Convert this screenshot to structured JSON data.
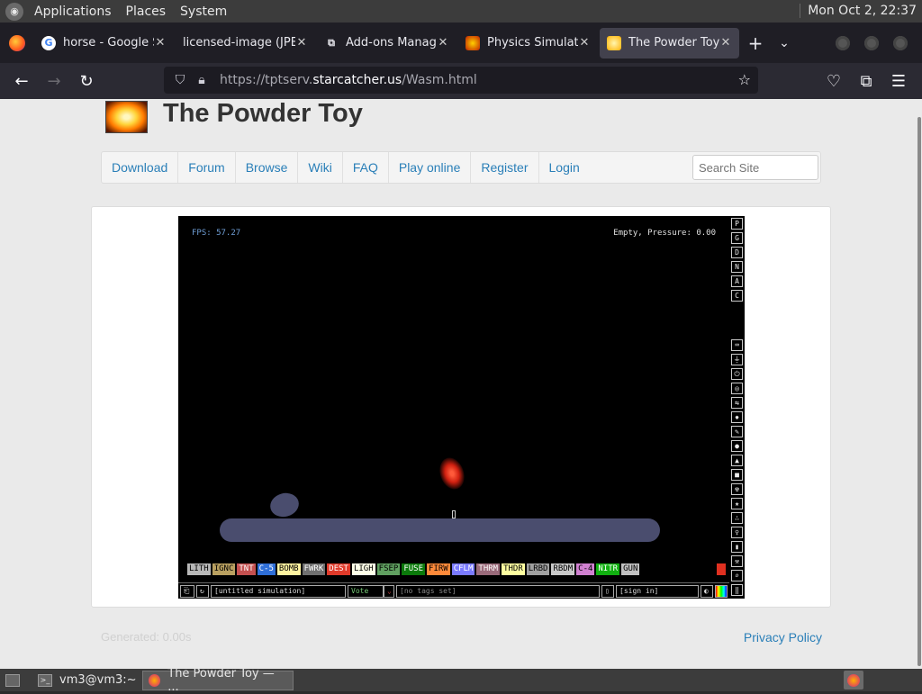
{
  "desktop": {
    "menus": [
      "Applications",
      "Places",
      "System"
    ],
    "clock": "Mon Oct  2, 22:37"
  },
  "browser": {
    "tabs": [
      {
        "title": "horse - Google S",
        "icon": "google-icon",
        "active": false
      },
      {
        "title": "licensed-image (JPE",
        "icon": "",
        "active": false
      },
      {
        "title": "Add-ons Manage",
        "icon": "puzzle-icon",
        "active": false
      },
      {
        "title": "Physics Simulati",
        "icon": "powder-toy-icon",
        "active": false
      },
      {
        "title": "The Powder Toy",
        "icon": "powder-toy-icon",
        "active": true
      }
    ],
    "url_prefix": "https://tptserv.",
    "url_domain": "starcatcher.us",
    "url_path": "/Wasm.html"
  },
  "site": {
    "title": "The Powder Toy",
    "nav": [
      "Download",
      "Forum",
      "Browse",
      "Wiki",
      "FAQ",
      "Play online",
      "Register",
      "Login"
    ],
    "search_placeholder": "Search Site",
    "generated": "Generated: 0.00s",
    "privacy": "Privacy Policy"
  },
  "simulation": {
    "fps": "FPS: 57.27",
    "status": "Empty, Pressure: 0.00",
    "right_letters": [
      "P",
      "G",
      "D",
      "N",
      "A",
      "C"
    ],
    "elements": [
      {
        "label": "LITH",
        "color": "#b8b8b8"
      },
      {
        "label": "IGNC",
        "color": "#b9a060"
      },
      {
        "label": "TNT",
        "color": "#c45050"
      },
      {
        "label": "C-5",
        "color": "#2f6fd8"
      },
      {
        "label": "BOMB",
        "color": "#fff3a0"
      },
      {
        "label": "FWRK",
        "color": "#707070"
      },
      {
        "label": "DEST",
        "color": "#e03a2a"
      },
      {
        "label": "LIGH",
        "color": "#ffffe8"
      },
      {
        "label": "FSEP",
        "color": "#60a060"
      },
      {
        "label": "FUSE",
        "color": "#0b7a0b"
      },
      {
        "label": "FIRW",
        "color": "#ff8a3a"
      },
      {
        "label": "CFLM",
        "color": "#7a7aff"
      },
      {
        "label": "THRM",
        "color": "#9a6a7a"
      },
      {
        "label": "THDR",
        "color": "#ffffa0"
      },
      {
        "label": "LRBD",
        "color": "#a0a0a0"
      },
      {
        "label": "RBDM",
        "color": "#c8c8c8"
      },
      {
        "label": "C-4",
        "color": "#d080d0"
      },
      {
        "label": "NITR",
        "color": "#10b010"
      },
      {
        "label": "GUN",
        "color": "#c0c0c0"
      }
    ],
    "save_name": "[untitled simulation]",
    "vote": "Vote",
    "tags": "[no tags set]",
    "signin": "[sign in]"
  },
  "taskbar": {
    "items": [
      "vm3@vm3:~",
      "The Powder Toy — ..."
    ]
  }
}
